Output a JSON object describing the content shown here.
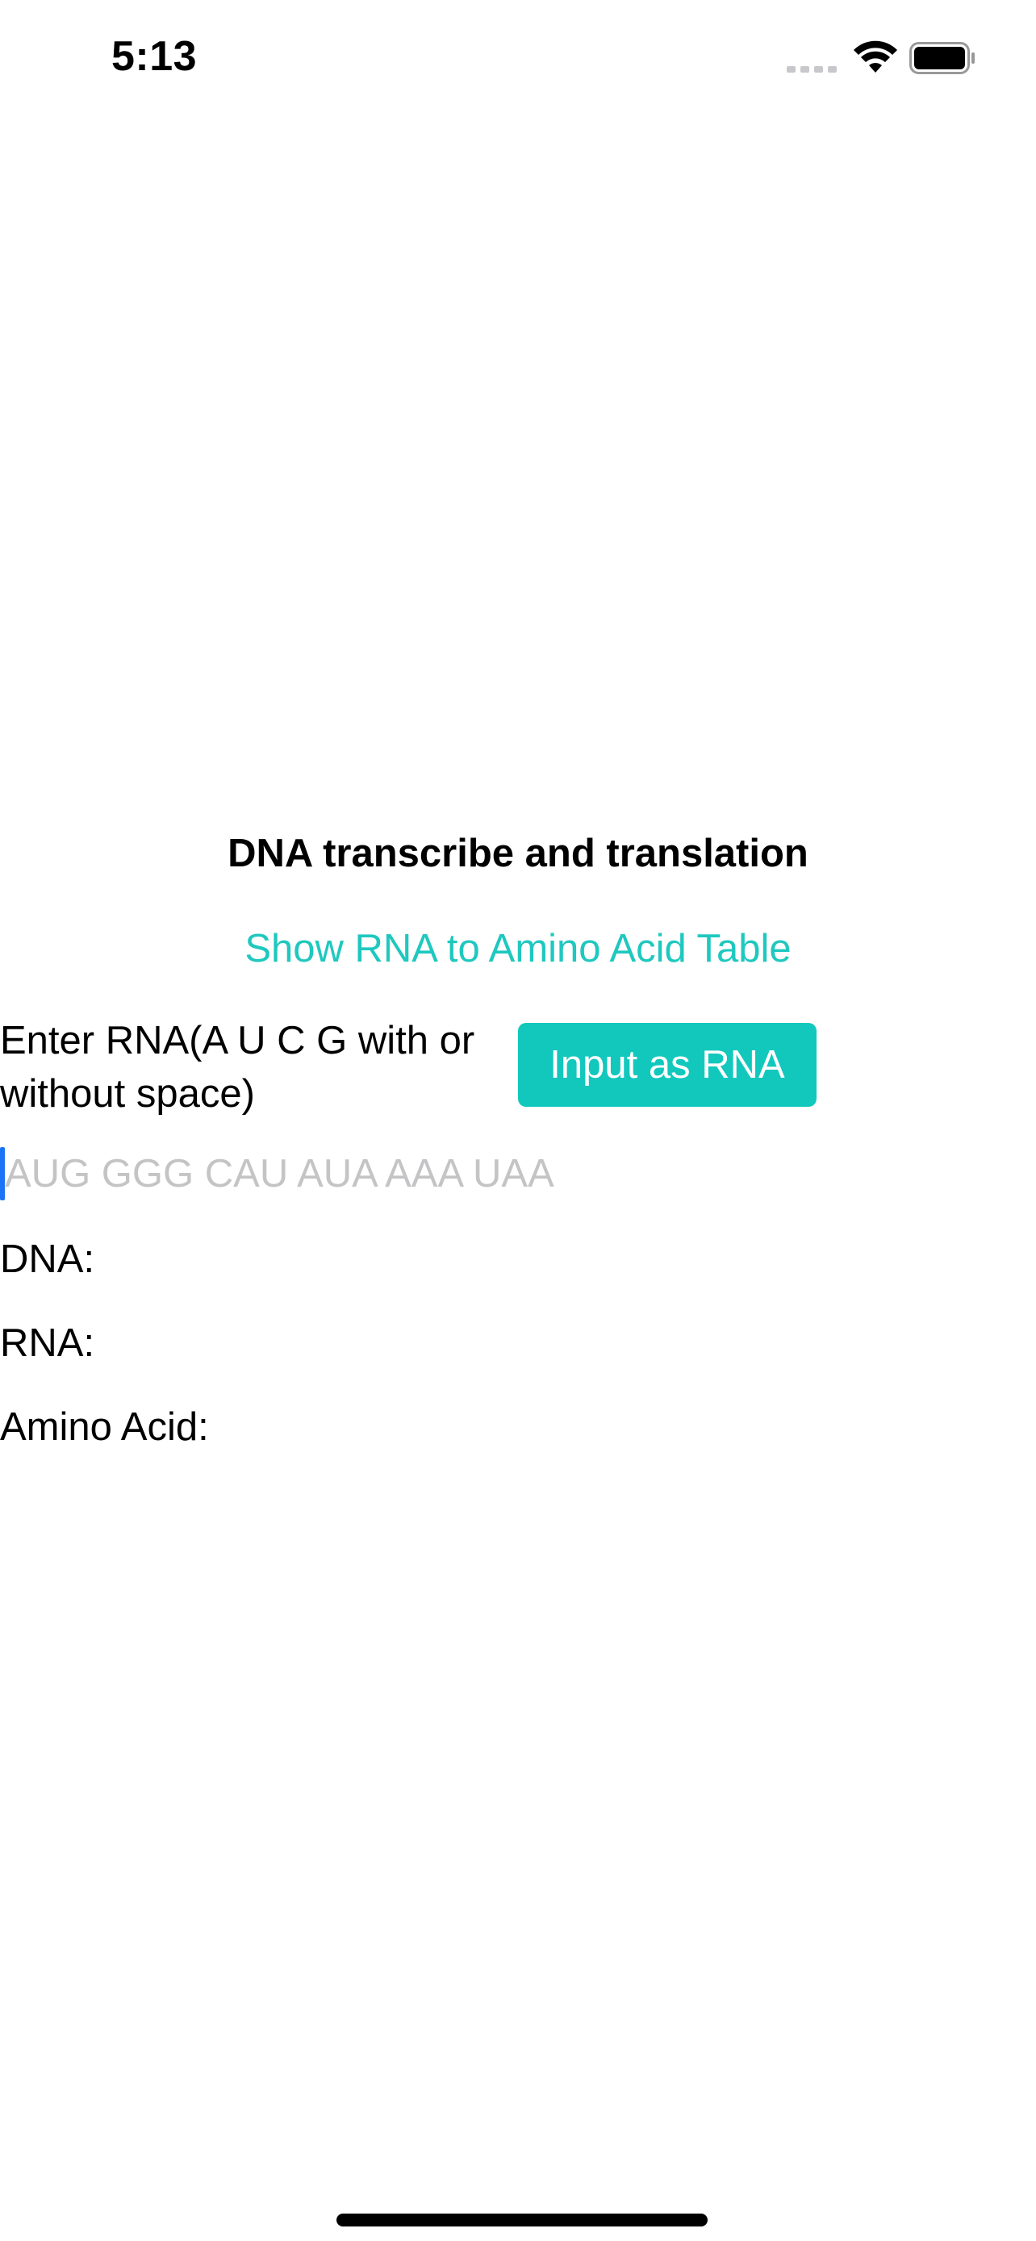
{
  "status_bar": {
    "time": "5:13",
    "icons": [
      "signal-icon",
      "wifi-icon",
      "battery-icon"
    ]
  },
  "main": {
    "title": "DNA transcribe and translation",
    "table_link_label": "Show RNA to Amino Acid Table",
    "enter_label": "Enter RNA(A U C G with or without space)",
    "input_button_label": "Input as RNA",
    "rna_input": {
      "value": "",
      "placeholder": "AUG GGG CAU AUA AAA UAA"
    },
    "dna_label": "DNA:",
    "rna_label": "RNA:",
    "amino_label": "Amino Acid:"
  },
  "colors": {
    "accent": "#12c8bd",
    "link": "#1fc8bf",
    "caret": "#1a74f5",
    "placeholder": "#c4c4c6"
  }
}
